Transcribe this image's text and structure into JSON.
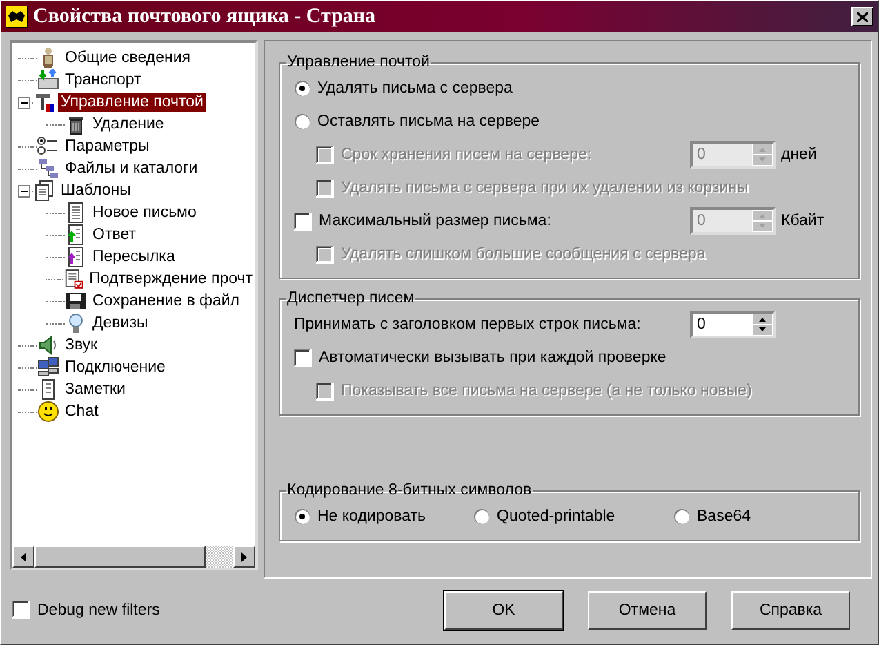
{
  "window": {
    "title": "Свойства почтового ящика - Страна"
  },
  "tree": [
    {
      "label": "Общие сведения",
      "selected": false
    },
    {
      "label": "Транспорт",
      "selected": false
    },
    {
      "label": "Управление почтой",
      "selected": true,
      "expanded": true,
      "children": [
        {
          "label": "Удаление",
          "selected": false
        }
      ]
    },
    {
      "label": "Параметры",
      "selected": false
    },
    {
      "label": "Файлы и каталоги",
      "selected": false
    },
    {
      "label": "Шаблоны",
      "selected": false,
      "expanded": true,
      "children": [
        {
          "label": "Новое письмо",
          "selected": false
        },
        {
          "label": "Ответ",
          "selected": false
        },
        {
          "label": "Пересылка",
          "selected": false
        },
        {
          "label": "Подтверждение прочт",
          "selected": false
        },
        {
          "label": "Сохранение в файл",
          "selected": false
        },
        {
          "label": "Девизы",
          "selected": false
        }
      ]
    },
    {
      "label": "Звук",
      "selected": false
    },
    {
      "label": "Подключение",
      "selected": false
    },
    {
      "label": "Заметки",
      "selected": false
    },
    {
      "label": "Chat",
      "selected": false
    }
  ],
  "mail_management": {
    "title": "Управление почтой",
    "options": [
      {
        "kind": "radio",
        "label": "Удалять письма с сервера",
        "selected": true,
        "disabled": false
      },
      {
        "kind": "radio",
        "label": "Оставлять письма на сервере",
        "selected": false,
        "disabled": false,
        "children": [
          {
            "kind": "checkbox",
            "label": "Срок хранения писем на сервере:",
            "checked": false,
            "disabled": true,
            "spin": {
              "value": "0",
              "disabled": true
            },
            "unit": "дней"
          },
          {
            "kind": "checkbox",
            "label": "Удалять письма с сервера при их удалении из корзины",
            "checked": false,
            "disabled": true
          }
        ]
      },
      {
        "kind": "checkbox",
        "label": "Максимальный размер письма:",
        "checked": false,
        "disabled": false,
        "spin": {
          "value": "0",
          "disabled": true
        },
        "unit": "Кбайт",
        "children": [
          {
            "kind": "checkbox",
            "label": "Удалять слишком большие сообщения с сервера",
            "checked": false,
            "disabled": true
          }
        ]
      }
    ]
  },
  "dispatcher": {
    "title": "Диспетчер писем",
    "options": [
      {
        "kind": "field",
        "label": "Принимать с заголовком первых строк письма:",
        "disabled": false,
        "spin": {
          "value": "0",
          "disabled": false
        }
      },
      {
        "kind": "checkbox",
        "label": "Автоматически вызывать при каждой проверке",
        "checked": false,
        "disabled": false,
        "children": [
          {
            "kind": "checkbox",
            "label": "Показывать все письма на сервере (а не только новые)",
            "checked": false,
            "disabled": true
          }
        ]
      }
    ]
  },
  "encoding": {
    "title": "Кодирование 8-битных символов",
    "options": [
      {
        "label": "Не кодировать",
        "selected": true
      },
      {
        "label": "Quoted-printable",
        "selected": false
      },
      {
        "label": "Base64",
        "selected": false
      }
    ]
  },
  "debug_filters": {
    "label": "Debug new filters",
    "checked": false
  },
  "buttons": [
    {
      "label": "OK",
      "default": true
    },
    {
      "label": "Отмена",
      "default": false
    },
    {
      "label": "Справка",
      "default": false
    }
  ]
}
